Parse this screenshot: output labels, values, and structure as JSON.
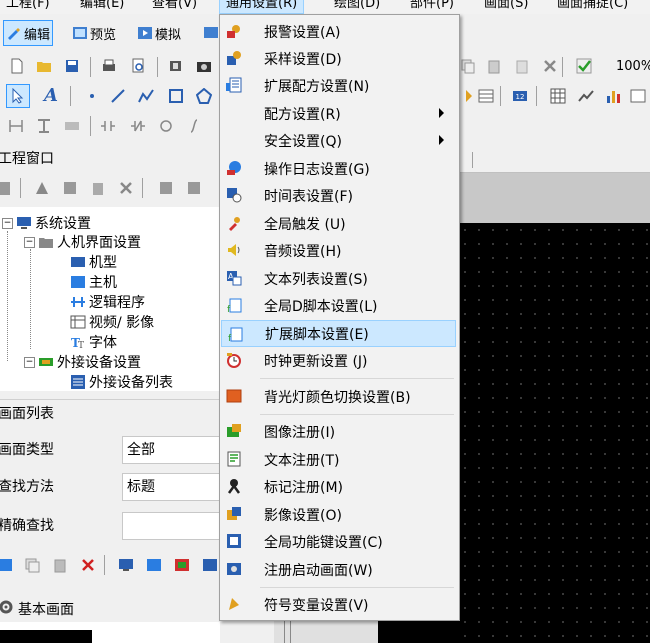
{
  "menubar": {
    "items": [
      "工程(F)",
      "编辑(E)",
      "查看(V)",
      "通用设置(R)",
      "绘图(D)",
      "部件(P)",
      "画面(S)",
      "画面捕捉(C)"
    ]
  },
  "toolbar1": {
    "edit_label": "编辑",
    "preview_label": "预览",
    "simulate_label": "模拟"
  },
  "toolbar2": {
    "zoom_value": "100%"
  },
  "project_window": {
    "title": "工程窗口",
    "tree": [
      {
        "label": "系统设置",
        "level": 0
      },
      {
        "label": "人机界面设置",
        "level": 1
      },
      {
        "label": "机型",
        "level": 2
      },
      {
        "label": "主机",
        "level": 2
      },
      {
        "label": "逻辑程序",
        "level": 2
      },
      {
        "label": "视频/ 影像",
        "level": 2
      },
      {
        "label": "字体",
        "level": 2
      },
      {
        "label": "外接设备设置",
        "level": 1
      },
      {
        "label": "外接设备列表",
        "level": 2
      }
    ]
  },
  "screen_list": {
    "title": "画面列表",
    "type_label": "画面类型",
    "type_value": "全部",
    "search_label": "查找方法",
    "search_value": "标题",
    "exact_label": "精确查找",
    "exact_value": "",
    "base_screen_label": "基本画面"
  },
  "dropdown_menu": {
    "items": [
      {
        "label": "报警设置(A)",
        "icon": "alarm-icon",
        "submenu": false
      },
      {
        "label": "采样设置(D)",
        "icon": "sampling-icon",
        "submenu": false
      },
      {
        "label": "扩展配方设置(N)",
        "icon": "extended-recipe-icon",
        "submenu": false
      },
      {
        "label": "配方设置(R)",
        "icon": "",
        "submenu": true
      },
      {
        "label": "安全设置(Q)",
        "icon": "",
        "submenu": true
      },
      {
        "label": "操作日志设置(G)",
        "icon": "operation-log-icon",
        "submenu": false
      },
      {
        "label": "时间表设置(F)",
        "icon": "schedule-icon",
        "submenu": false
      },
      {
        "label": "全局触发 (U)",
        "icon": "global-trigger-icon",
        "submenu": false
      },
      {
        "label": "音频设置(H)",
        "icon": "audio-icon",
        "submenu": false
      },
      {
        "label": "文本列表设置(S)",
        "icon": "text-list-icon",
        "submenu": false
      },
      {
        "label": "全局D脚本设置(L)",
        "icon": "global-script-icon",
        "submenu": false
      },
      {
        "label": "扩展脚本设置(E)",
        "icon": "extended-script-icon",
        "submenu": false,
        "highlighted": true
      },
      {
        "label": "时钟更新设置 (J)",
        "icon": "clock-update-icon",
        "submenu": false
      },
      {
        "label": "背光灯颜色切换设置(B)",
        "icon": "backlight-color-icon",
        "submenu": false
      },
      {
        "label": "图像注册(I)",
        "icon": "image-register-icon",
        "submenu": false
      },
      {
        "label": "文本注册(T)",
        "icon": "text-register-icon",
        "submenu": false
      },
      {
        "label": "标记注册(M)",
        "icon": "mark-register-icon",
        "submenu": false
      },
      {
        "label": "影像设置(O)",
        "icon": "video-settings-icon",
        "submenu": false
      },
      {
        "label": "全局功能键设置(C)",
        "icon": "function-key-icon",
        "submenu": false
      },
      {
        "label": "注册启动画面(W)",
        "icon": "startup-screen-icon",
        "submenu": false
      },
      {
        "label": "符号变量设置(V)",
        "icon": "symbol-variable-icon",
        "submenu": false
      }
    ]
  },
  "colors": {
    "highlight": "#cce8ff",
    "highlight_border": "#99d1ff",
    "canvas": "#000000"
  }
}
